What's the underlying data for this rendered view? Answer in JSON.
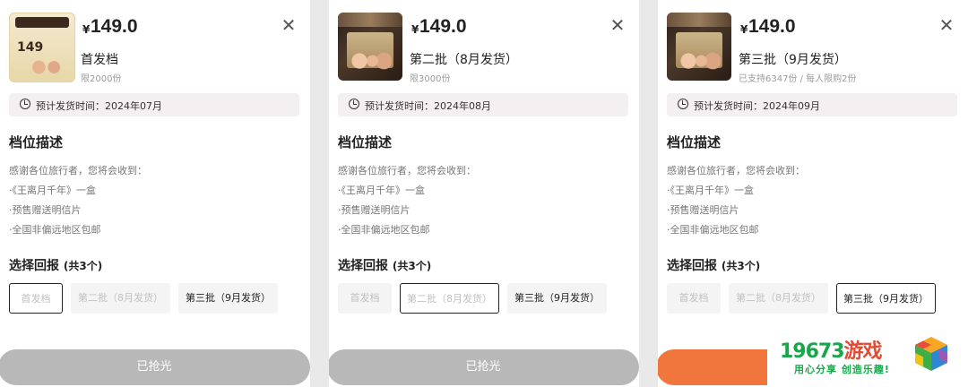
{
  "currency_symbol": "¥",
  "panels": [
    {
      "price": "149.0",
      "tier_name": "首发档",
      "tier_sub": "限2000份",
      "ship_text": "预计发货时间：2024年07月",
      "desc_heading": "档位描述",
      "desc_lines": [
        "感谢各位旅行者，您将会收到：",
        "·《王离月千年》一盒",
        "·预售赠送明信片",
        "·全国非偏远地区包邮"
      ],
      "select_heading": "选择回报",
      "select_count": "(共3个)",
      "options": [
        "首发档",
        "第二批（8月发货）",
        "第三批（9月发货）"
      ],
      "cta": "已抢光",
      "thumb_text": "149",
      "thumb_variant": "first"
    },
    {
      "price": "149.0",
      "tier_name": "第二批（8月发货）",
      "tier_sub": "限3000份",
      "ship_text": "预计发货时间：2024年08月",
      "desc_heading": "档位描述",
      "desc_lines": [
        "感谢各位旅行者，您将会收到：",
        "·《王离月千年》一盒",
        "·预售赠送明信片",
        "·全国非偏远地区包邮"
      ],
      "select_heading": "选择回报",
      "select_count": "(共3个)",
      "options": [
        "首发档",
        "第二批（8月发货）",
        "第三批（9月发货）"
      ],
      "cta": "已抢光"
    },
    {
      "price": "149.0",
      "tier_name": "第三批（9月发货）",
      "tier_sub": "已支持6347份 / 每人限购2份",
      "ship_text": "预计发货时间：2024年09月",
      "desc_heading": "档位描述",
      "desc_lines": [
        "感谢各位旅行者，您将会收到：",
        "·《王离月千年》一盒",
        "·预售赠送明信片",
        "·全国非偏远地区包邮"
      ],
      "select_heading": "选择回报",
      "select_count": "(共3个)",
      "options": [
        "首发档",
        "第二批（8月发货）",
        "第三批（9月发货）"
      ],
      "cta": ""
    }
  ],
  "icons": {
    "close": "close-icon",
    "clock": "clock-icon"
  },
  "watermark": {
    "number": "19673",
    "brand": "游戏",
    "tagline": "用心分享 创造乐趣!"
  },
  "colors": {
    "cta_disabled": "#b8b8b8",
    "cta_active": "#f1763d",
    "watermark_green": "#17a74a"
  }
}
